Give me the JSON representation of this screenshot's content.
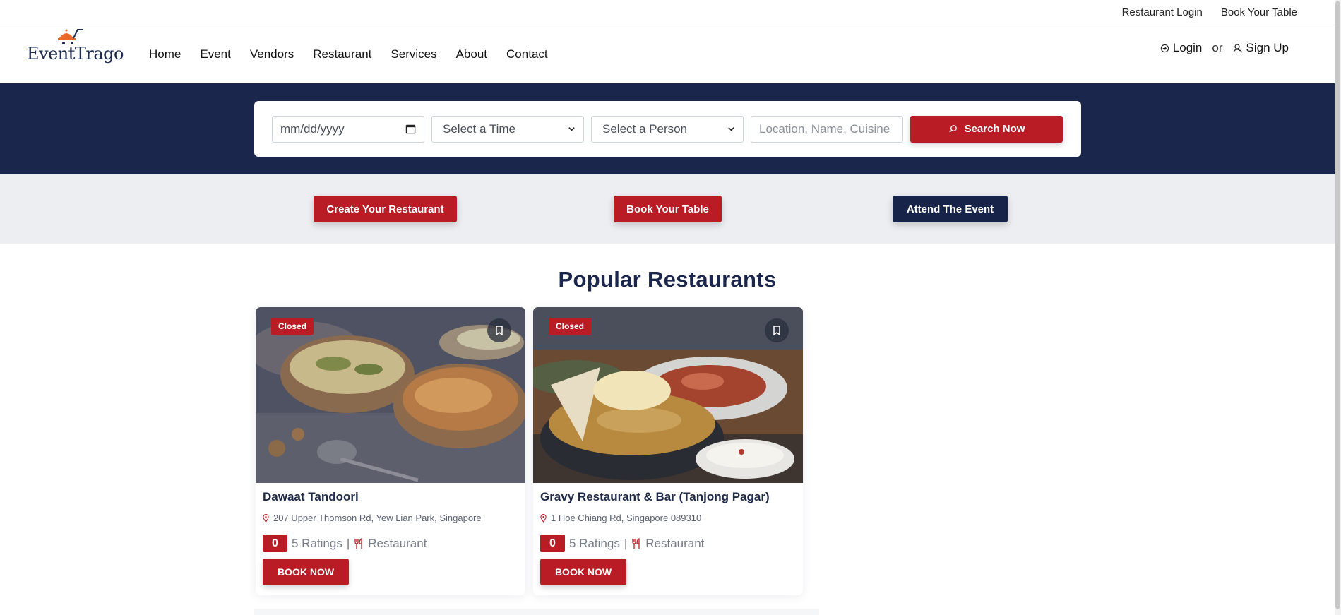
{
  "topbar": {
    "restaurant_login": "Restaurant Login",
    "book_table": "Book Your Table"
  },
  "logo": {
    "text": "EventTrago"
  },
  "menu": [
    "Home",
    "Event",
    "Vendors",
    "Restaurant",
    "Services",
    "About",
    "Contact"
  ],
  "auth": {
    "login": "Login",
    "or": "or",
    "signup": "Sign Up"
  },
  "search": {
    "date_placeholder": "mm/dd/yyyy",
    "time_selected": "Select a Time",
    "person_selected": "Select a Person",
    "location_placeholder": "Location, Name, Cuisine",
    "button": "Search Now"
  },
  "actions": {
    "create": "Create Your Restaurant",
    "book": "Book Your Table",
    "attend": "Attend The Event"
  },
  "section_title": "Popular Restaurants",
  "restaurants": [
    {
      "status": "Closed",
      "name": "Dawaat Tandoori",
      "address": "207 Upper Thomson Rd, Yew Lian Park, Singapore",
      "rating": "0",
      "ratings_text": "5 Ratings",
      "category": "Restaurant",
      "button": "BOOK NOW"
    },
    {
      "status": "Closed",
      "name": "Gravy Restaurant & Bar (Tanjong Pagar)",
      "address": "1 Hoe Chiang Rd, Singapore 089310",
      "rating": "0",
      "ratings_text": "5 Ratings",
      "category": "Restaurant",
      "button": "BOOK NOW"
    }
  ],
  "colors": {
    "brand_red": "#b91c24",
    "navy": "#1b264d",
    "light_bg": "#edeef1"
  },
  "icons": [
    "calendar-icon",
    "chevron-down-icon",
    "search-icon",
    "login-icon",
    "user-icon",
    "bookmark-icon",
    "location-pin-icon",
    "cutlery-icon"
  ]
}
